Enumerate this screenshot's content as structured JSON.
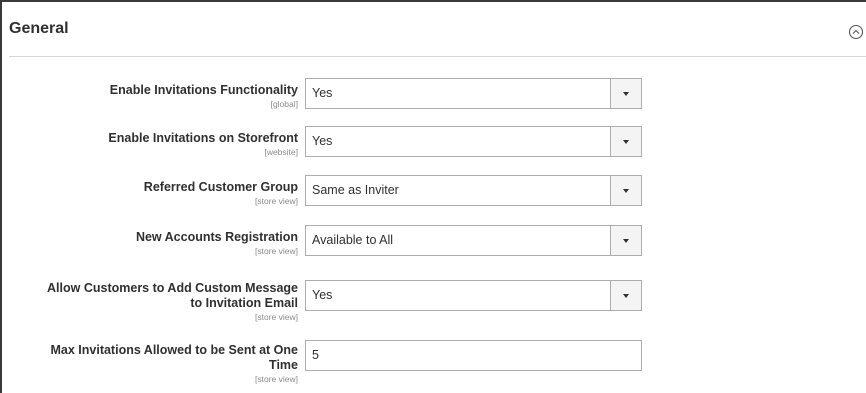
{
  "section": {
    "title": "General"
  },
  "fields": [
    {
      "label": "Enable Invitations Functionality",
      "scope": "[global]",
      "value": "Yes"
    },
    {
      "label": "Enable Invitations on Storefront",
      "scope": "[website]",
      "value": "Yes"
    },
    {
      "label": "Referred Customer Group",
      "scope": "[store view]",
      "value": "Same as Inviter"
    },
    {
      "label": "New Accounts Registration",
      "scope": "[store view]",
      "value": "Available to All"
    },
    {
      "label_line1": "Allow Customers to Add Custom Message",
      "label_line2": "to Invitation Email",
      "scope": "[store view]",
      "value": "Yes"
    },
    {
      "label_line1": "Max Invitations Allowed to be Sent at One",
      "label_line2": "Time",
      "scope": "[store view]",
      "value": "5"
    }
  ],
  "icons": {
    "collapse": "chevron-up-circle-icon",
    "dropdown": "chevron-down-icon"
  }
}
